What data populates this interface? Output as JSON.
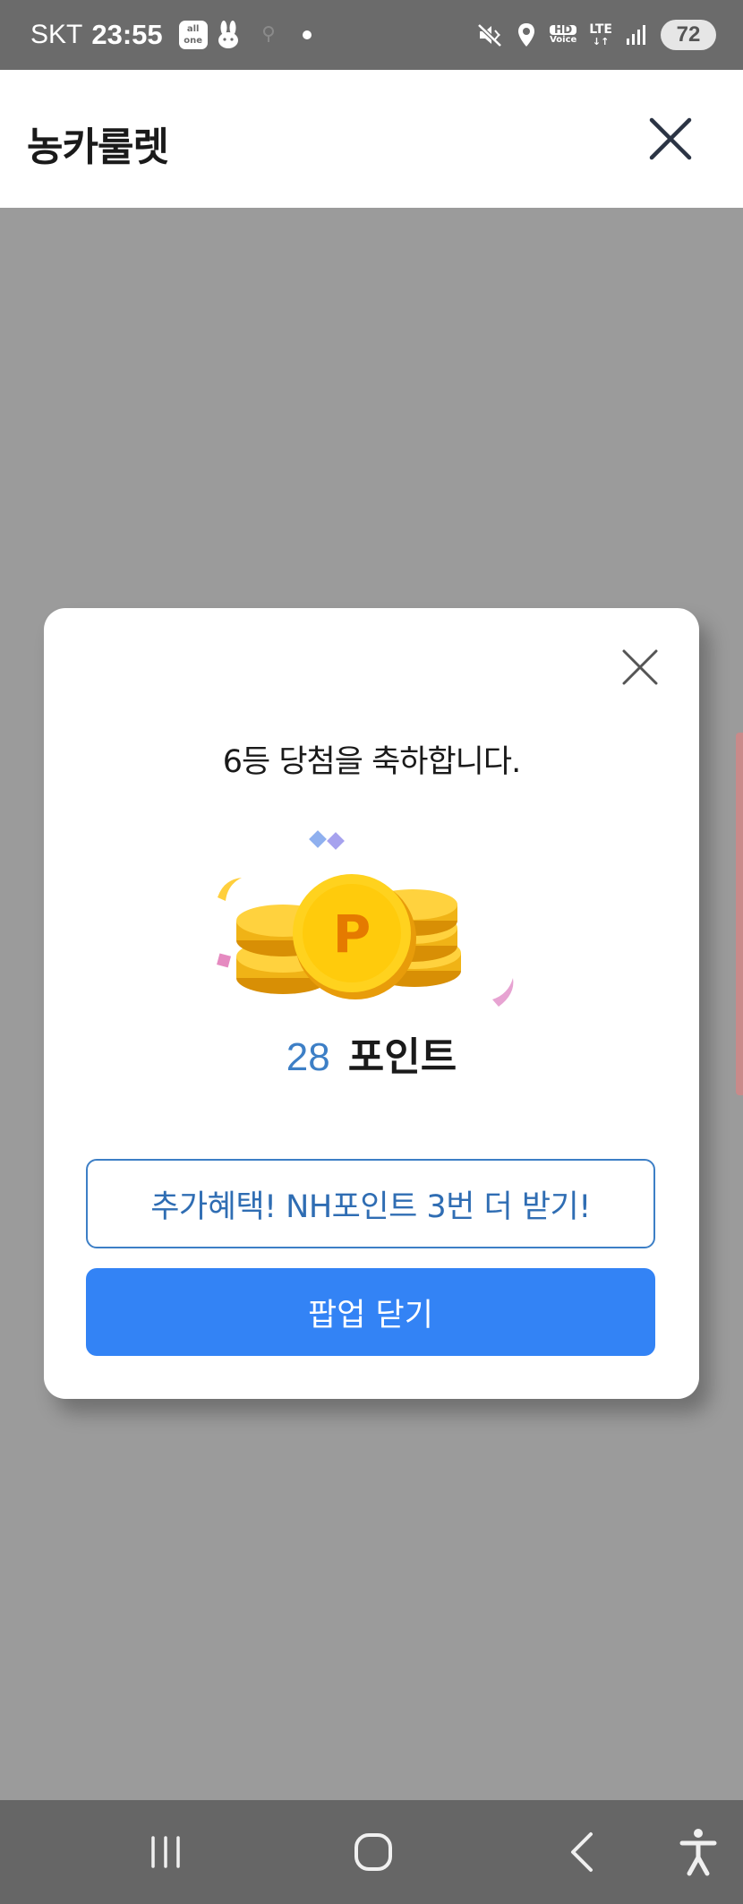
{
  "status_bar": {
    "carrier": "SKT",
    "time": "23:55",
    "app_badge_top": "all",
    "app_badge_bottom": "one",
    "hd_top": "HD",
    "hd_bottom": "Voice",
    "network": "LTE",
    "battery": "72"
  },
  "header": {
    "title": "농카룰렛",
    "close_icon": "close-icon"
  },
  "modal": {
    "heading": "6등 당첨을 축하합니다.",
    "points_value": "28",
    "points_unit": "포인트",
    "extra_button_label": "추가혜택! NH포인트 3번 더 받기!",
    "close_button_label": "팝업 닫기",
    "coin_letter": "P",
    "accent_color": "#3383f5",
    "points_color": "#3d7fc6"
  },
  "nav_bar": {
    "recent_icon": "recent-apps-icon",
    "home_icon": "home-icon",
    "back_icon": "back-icon",
    "accessibility_icon": "accessibility-icon"
  }
}
